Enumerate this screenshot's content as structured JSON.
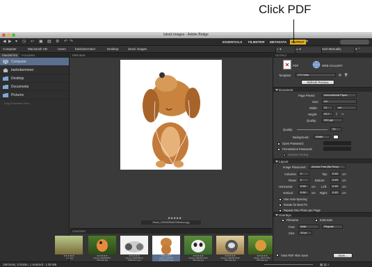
{
  "callout": {
    "text": "Click PDF"
  },
  "window": {
    "title": "istock images - Adobe Bridge"
  },
  "workspaces": [
    "ESSENTIALS",
    "FILMSTRIP",
    "METADATA",
    "OUTPUT"
  ],
  "active_workspace": "OUTPUT",
  "search_placeholder": "",
  "path": [
    "Computer",
    "Macintosh HD",
    "Users",
    "barbobermeier",
    "Desktop",
    "istock images"
  ],
  "sort": "Sort Manually",
  "left_panel": {
    "tabs": [
      "FAVORITES",
      "FOLDERS"
    ],
    "items": [
      "Computer",
      "barbobermeier",
      "Desktop",
      "Documents",
      "Pictures"
    ],
    "hint": "Drag Favorites Here..."
  },
  "preview": {
    "tab": "PREVIEW",
    "stars": "★★★★★",
    "filename": "iStock_000005054437Medium.jpg"
  },
  "content": {
    "tab": "CONTENT",
    "thumbnails": [
      {
        "caption": "...ium.jpg",
        "stars": "★★★★★"
      },
      {
        "caption": "iStock_000004567 33Large.jpg",
        "stars": "★★★★★"
      },
      {
        "caption": "iStock_000004813 34Medium.jpg",
        "stars": "★★★★★"
      },
      {
        "caption": "iStock_000005 437Medium.jpg",
        "stars": "★★★★★"
      },
      {
        "caption": "iStock_000006 1304 99Large.jpg",
        "stars": "★★★★★"
      },
      {
        "caption": "iStock_000006 8316 89Large.jpg",
        "stars": "★★★★★"
      },
      {
        "caption": "iStock_0000 7860 85Large.jpg",
        "stars": "★★★★★"
      }
    ]
  },
  "output": {
    "tab": "OUTPUT",
    "pdf_label": "PDF",
    "web_gallery_label": "WEB GALLERY",
    "template_label": "Template:",
    "template_value": "2*2 Cells",
    "refresh_button": "Refresh Preview",
    "document_header": "Document",
    "page_preset_label": "Page Preset:",
    "page_preset_value": "International Paper",
    "size_label": "Size:",
    "size_value": "A4",
    "width_label": "Width:",
    "width_value": "21",
    "width_unit": "cm",
    "height_label": "Height:",
    "height_value": "29.7",
    "quality_label": "Quality:",
    "quality_value": "300 ppi",
    "quality2_label": "Quality:",
    "quality2_value": "70",
    "background_label": "Background:",
    "background_value": "White",
    "open_password_label": "Open Password:",
    "permissions_password_label": "Permissions Password:",
    "disable_printing_label": "Disable Printing",
    "layout_header": "Layout",
    "image_placement_label": "Image Placement:",
    "image_placement_value": "Across First (By Row)",
    "columns_label": "Columns:",
    "columns_value": "2",
    "rows_label": "Rows:",
    "rows_value": "2",
    "horizontal_label": "Horizontal:",
    "horizontal_value": "0.64",
    "vertical_label": "Vertical:",
    "vertical_value": "0.64",
    "top_label": "Top:",
    "top_value": "0.43",
    "bottom_label": "Bottom:",
    "bottom_value": "0.43",
    "left_label": "Left:",
    "left_value": "0.43",
    "right_label": "Right:",
    "right_value": "0.43",
    "unit_cm": "cm",
    "auto_spacing_label": "Use Auto-Spacing",
    "rotate_label": "Rotate for Best Fit",
    "repeat_label": "Repeat One Photo per Page",
    "overlays_header": "Overlays",
    "filename_label": "Filename",
    "extension_label": "Extension",
    "font_label": "Font:",
    "font_value": "Arial",
    "font_style_value": "Regular",
    "font_size_label": "Size:",
    "font_size_value": "10 pt",
    "view_pdf_label": "View PDF After Save",
    "save_button": "Save..."
  },
  "status": {
    "text": "189 items, 5 hidden, 1 selected - 1.95 MB"
  },
  "colors": {
    "accent": "#e8b21e",
    "selection": "#5b6f8e"
  }
}
